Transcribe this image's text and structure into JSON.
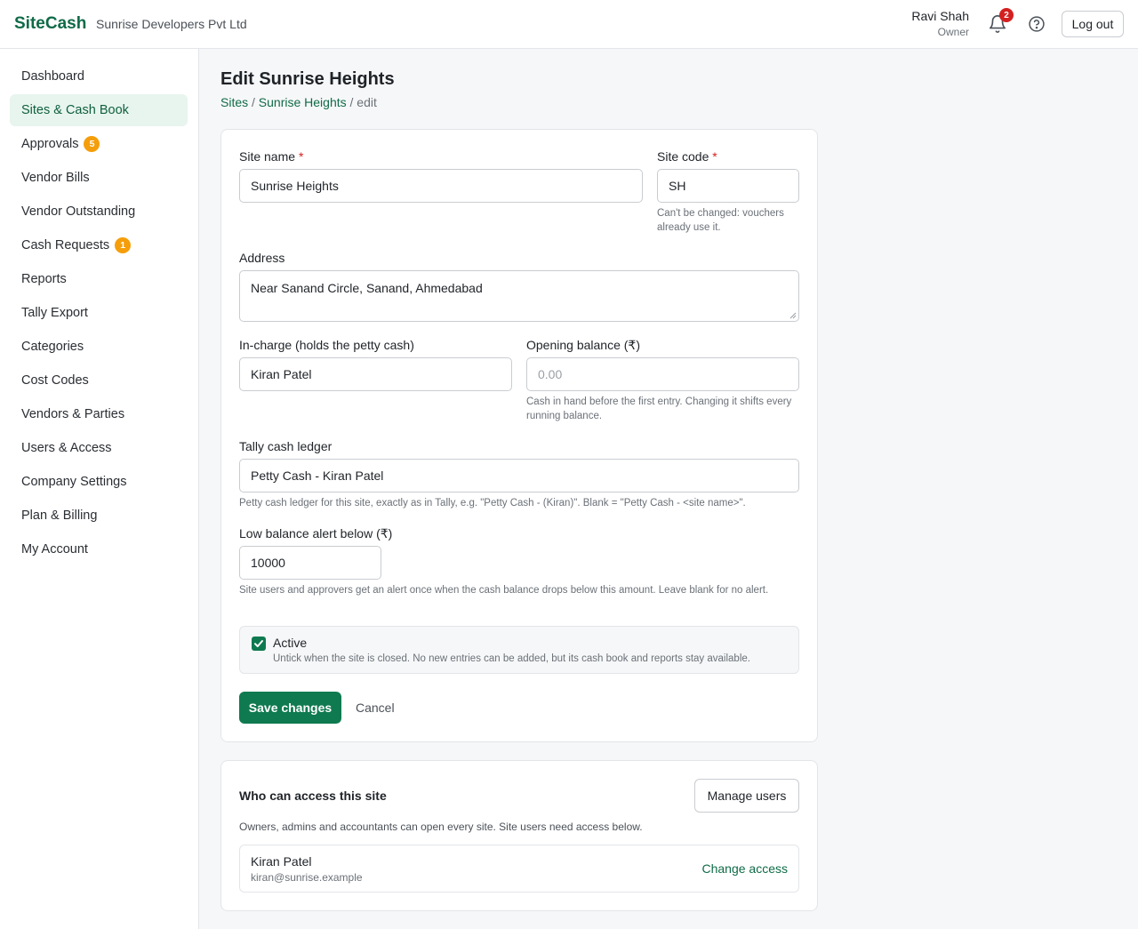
{
  "header": {
    "brand": "SiteCash",
    "company": "Sunrise Developers Pvt Ltd",
    "user_name": "Ravi Shah",
    "user_role": "Owner",
    "notification_count": "2",
    "logout_label": "Log out"
  },
  "sidebar": {
    "items": [
      {
        "label": "Dashboard",
        "badge": ""
      },
      {
        "label": "Sites & Cash Book",
        "badge": ""
      },
      {
        "label": "Approvals",
        "badge": "5"
      },
      {
        "label": "Vendor Bills",
        "badge": ""
      },
      {
        "label": "Vendor Outstanding",
        "badge": ""
      },
      {
        "label": "Cash Requests",
        "badge": "1"
      },
      {
        "label": "Reports",
        "badge": ""
      },
      {
        "label": "Tally Export",
        "badge": ""
      },
      {
        "label": "Categories",
        "badge": ""
      },
      {
        "label": "Cost Codes",
        "badge": ""
      },
      {
        "label": "Vendors & Parties",
        "badge": ""
      },
      {
        "label": "Users & Access",
        "badge": ""
      },
      {
        "label": "Company Settings",
        "badge": ""
      },
      {
        "label": "Plan & Billing",
        "badge": ""
      },
      {
        "label": "My Account",
        "badge": ""
      }
    ]
  },
  "page": {
    "title": "Edit Sunrise Heights",
    "breadcrumb": {
      "sites": "Sites",
      "site": "Sunrise Heights",
      "current": "edit",
      "sep": "/"
    }
  },
  "form": {
    "site_name": {
      "label": "Site name",
      "value": "Sunrise Heights"
    },
    "site_code": {
      "label": "Site code",
      "value": "SH",
      "hint": "Can't be changed: vouchers already use it."
    },
    "address": {
      "label": "Address",
      "value": "Near Sanand Circle, Sanand, Ahmedabad"
    },
    "in_charge": {
      "label": "In-charge (holds the petty cash)",
      "value": "Kiran Patel"
    },
    "opening_balance": {
      "label": "Opening balance (₹)",
      "placeholder": "0.00",
      "hint": "Cash in hand before the first entry. Changing it shifts every running balance."
    },
    "tally_ledger": {
      "label": "Tally cash ledger",
      "value": "Petty Cash - Kiran Patel",
      "hint": "Petty cash ledger for this site, exactly as in Tally, e.g. \"Petty Cash - (Kiran)\". Blank = \"Petty Cash - <site name>\"."
    },
    "low_balance": {
      "label": "Low balance alert below (₹)",
      "value": "10000",
      "hint": "Site users and approvers get an alert once when the cash balance drops below this amount. Leave blank for no alert."
    },
    "active": {
      "label": "Active",
      "checked": true,
      "hint": "Untick when the site is closed. No new entries can be added, but its cash book and reports stay available."
    },
    "save_label": "Save changes",
    "cancel_label": "Cancel",
    "required_mark": "*"
  },
  "access": {
    "title": "Who can access this site",
    "manage_label": "Manage users",
    "description": "Owners, admins and accountants can open every site. Site users need access below.",
    "users": [
      {
        "name": "Kiran Patel",
        "email": "kiran@sunrise.example",
        "action": "Change access"
      }
    ]
  },
  "colors": {
    "brand": "#0f6b47",
    "primary_button": "#0f7a50",
    "badge": "#f59e0b",
    "notification": "#d42020"
  },
  "icons": {
    "bell": "bell-icon",
    "help": "help-icon",
    "check": "check-icon"
  }
}
